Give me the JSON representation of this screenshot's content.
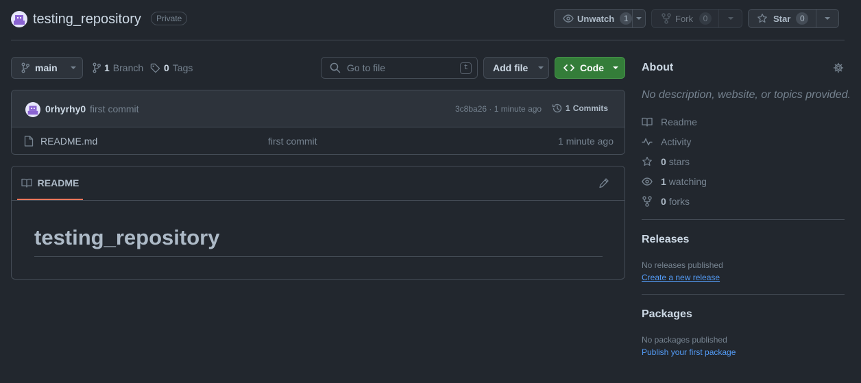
{
  "header": {
    "repo_name": "testing_repository",
    "visibility": "Private",
    "unwatch_label": "Unwatch",
    "unwatch_count": "1",
    "fork_label": "Fork",
    "fork_count": "0",
    "star_label": "Star",
    "star_count": "0"
  },
  "toolbar": {
    "branch": "main",
    "branch_count": "1",
    "branch_label": "Branch",
    "tag_count": "0",
    "tag_label": "Tags",
    "search_placeholder": "Go to file",
    "search_shortcut": "t",
    "add_file_label": "Add file",
    "code_label": "Code"
  },
  "commit": {
    "author": "0rhyrhy0",
    "message": "first commit",
    "hash_time": "3c8ba26 · 1 minute ago",
    "commits_count": "1",
    "commits_label": "Commits"
  },
  "files": [
    {
      "name": "README.md",
      "message": "first commit",
      "time": "1 minute ago"
    }
  ],
  "readme": {
    "tab_label": "README",
    "heading": "testing_repository"
  },
  "about": {
    "title": "About",
    "description": "No description, website, or topics provided.",
    "items": [
      {
        "icon": "book-icon",
        "label": "Readme"
      },
      {
        "icon": "pulse-icon",
        "label": "Activity"
      },
      {
        "icon": "star-icon",
        "count": "0",
        "label": "stars"
      },
      {
        "icon": "eye-icon",
        "count": "1",
        "label": "watching"
      },
      {
        "icon": "fork-icon",
        "count": "0",
        "label": "forks"
      }
    ]
  },
  "releases": {
    "title": "Releases",
    "empty": "No releases published",
    "link": "Create a new release"
  },
  "packages": {
    "title": "Packages",
    "empty": "No packages published",
    "link": "Publish your first package"
  },
  "colors": {
    "background": "#22272e",
    "border": "#444c56",
    "accent_green": "#347d39",
    "link_blue": "#539bf5",
    "readme_tab_underline": "#ec775c"
  }
}
